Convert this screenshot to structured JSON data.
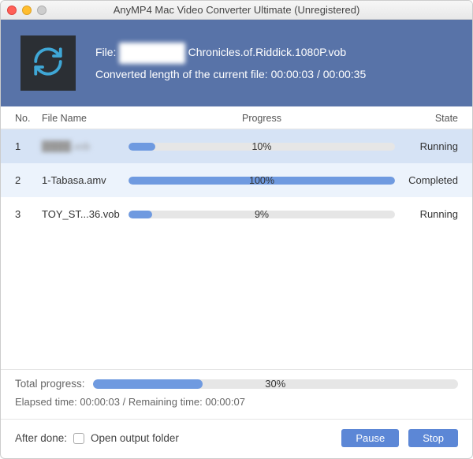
{
  "window": {
    "title": "AnyMP4 Mac Video Converter Ultimate (Unregistered)"
  },
  "header": {
    "file_label": "File:",
    "file_obscured": "████████",
    "file_rest": " Chronicles.of.Riddick.1080P.vob",
    "converted_line": "Converted length of the current file: 00:00:03 / 00:00:35"
  },
  "columns": {
    "no": "No.",
    "name": "File Name",
    "progress": "Progress",
    "state": "State"
  },
  "rows": [
    {
      "no": "1",
      "name": "████.vob",
      "name_obscured": true,
      "progress_pct": 10,
      "progress_text": "10%",
      "state": "Running"
    },
    {
      "no": "2",
      "name": "1-Tabasa.amv",
      "name_obscured": false,
      "progress_pct": 100,
      "progress_text": "100%",
      "state": "Completed"
    },
    {
      "no": "3",
      "name": "TOY_ST...36.vob",
      "name_obscured": false,
      "progress_pct": 9,
      "progress_text": "9%",
      "state": "Running"
    }
  ],
  "total": {
    "label": "Total progress:",
    "pct": 30,
    "pct_text": "30%",
    "elapsed_label": "Elapsed time: 00:00:03 / Remaining time: 00:00:07"
  },
  "footer": {
    "after_done_label": "After done:",
    "checkbox_label": "Open output folder",
    "pause": "Pause",
    "stop": "Stop"
  }
}
